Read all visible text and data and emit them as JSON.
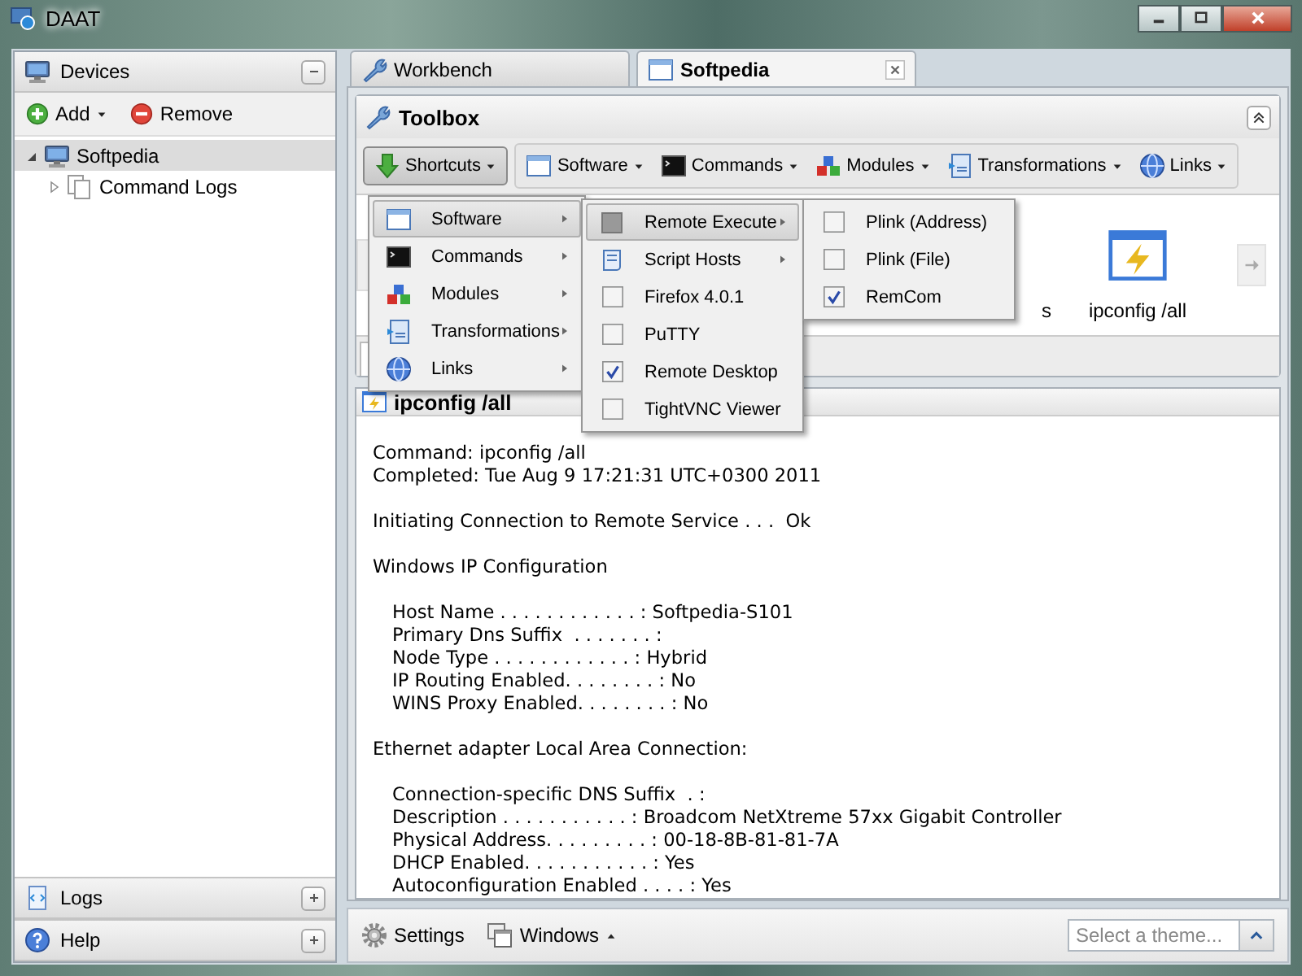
{
  "window": {
    "title": "DAAT"
  },
  "devices": {
    "title": "Devices",
    "actions": [
      {
        "label": "Add",
        "kind": "add"
      },
      {
        "label": "Remove",
        "kind": "remove"
      }
    ],
    "tree": [
      {
        "label": "Softpedia",
        "expanded": true,
        "selected": true,
        "children": [
          {
            "label": "Command Logs",
            "expanded": false,
            "selected": false
          }
        ]
      }
    ],
    "sections": [
      "Logs",
      "Help"
    ]
  },
  "tabs": [
    {
      "label": "Workbench",
      "selected": false,
      "closable": false
    },
    {
      "label": "Softpedia",
      "selected": true,
      "closable": true
    }
  ],
  "toolbox": {
    "title": "Toolbox",
    "buttons": [
      {
        "label": "Shortcuts",
        "selected": true
      },
      {
        "label": "Software",
        "selected": false
      },
      {
        "label": "Commands",
        "selected": false
      },
      {
        "label": "Modules",
        "selected": false
      },
      {
        "label": "Transformations",
        "selected": false
      },
      {
        "label": "Links",
        "selected": false
      }
    ],
    "shortcuts": [
      {
        "label": "s",
        "kind": "covered"
      },
      {
        "label": "ipconfig /all",
        "kind": "launcher"
      }
    ]
  },
  "menus": [
    {
      "items": [
        {
          "label": "Software",
          "kind": "submenu",
          "selected": true
        },
        {
          "label": "Commands",
          "kind": "submenu",
          "selected": false
        },
        {
          "label": "Modules",
          "kind": "submenu",
          "selected": false
        },
        {
          "label": "Transformations",
          "kind": "submenu",
          "selected": false
        },
        {
          "label": "Links",
          "kind": "submenu",
          "selected": false
        }
      ]
    },
    {
      "items": [
        {
          "label": "Remote Execute",
          "kind": "submenu",
          "selected": true
        },
        {
          "label": "Script Hosts",
          "kind": "submenu",
          "selected": false
        },
        {
          "label": "Firefox 4.0.1",
          "kind": "check",
          "checked": false
        },
        {
          "label": "PuTTY",
          "kind": "check",
          "checked": false
        },
        {
          "label": "Remote Desktop",
          "kind": "check",
          "checked": true
        },
        {
          "label": "TightVNC Viewer",
          "kind": "check",
          "checked": false
        }
      ]
    },
    {
      "items": [
        {
          "label": "Plink (Address)",
          "kind": "check",
          "checked": false
        },
        {
          "label": "Plink (File)",
          "kind": "check",
          "checked": false
        },
        {
          "label": "RemCom",
          "kind": "check",
          "checked": true
        }
      ]
    }
  ],
  "result": {
    "title": "ipconfig /all",
    "blocks": [
      {
        "indented": false,
        "lines": [
          "Command: ipconfig /all",
          "Completed: Tue Aug 9 17:21:31 UTC+0300 2011"
        ]
      },
      {
        "indented": false,
        "lines": [
          "Initiating Connection to Remote Service . . .  Ok"
        ]
      },
      {
        "indented": false,
        "lines": [
          "Windows IP Configuration"
        ]
      },
      {
        "indented": true,
        "lines": [
          "Host Name . . . . . . . . . . . . : Softpedia-S101",
          "Primary Dns Suffix  . . . . . . . :",
          "Node Type . . . . . . . . . . . . : Hybrid",
          "IP Routing Enabled. . . . . . . . : No",
          "WINS Proxy Enabled. . . . . . . . : No"
        ]
      },
      {
        "indented": false,
        "lines": [
          "Ethernet adapter Local Area Connection:"
        ]
      },
      {
        "indented": true,
        "lines": [
          "Connection-specific DNS Suffix  . :",
          "Description . . . . . . . . . . . : Broadcom NetXtreme 57xx Gigabit Controller",
          "Physical Address. . . . . . . . . : 00-18-8B-81-81-7A",
          "DHCP Enabled. . . . . . . . . . . : Yes",
          "Autoconfiguration Enabled . . . . : Yes"
        ]
      }
    ]
  },
  "bottom_bar": {
    "settings": "Settings",
    "windows": "Windows",
    "theme": {
      "placeholder": "Select a theme..."
    }
  }
}
